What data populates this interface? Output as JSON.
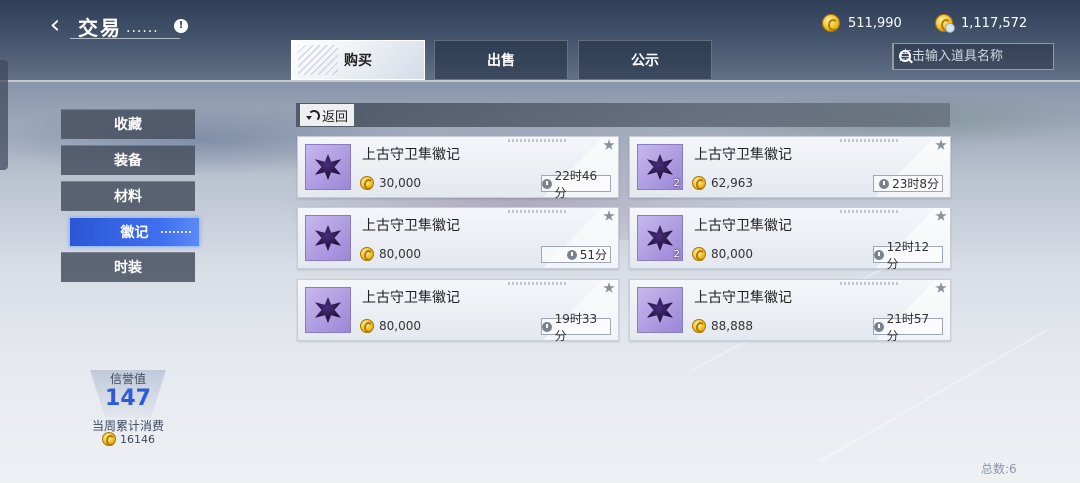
{
  "header": {
    "title": "交易",
    "title_dots": "......",
    "info_label": "!",
    "currencies": [
      {
        "icon": "gold-coin-icon",
        "value": "511,990"
      },
      {
        "icon": "bound-gold-coin-icon",
        "value": "1,117,572"
      }
    ]
  },
  "tabs": [
    {
      "label": "购买",
      "active": true
    },
    {
      "label": "出售",
      "active": false
    },
    {
      "label": "公示",
      "active": false
    }
  ],
  "search": {
    "placeholder": "点击输入道具名称",
    "value": ""
  },
  "categories": [
    {
      "label": "收藏",
      "active": false
    },
    {
      "label": "装备",
      "active": false
    },
    {
      "label": "材料",
      "active": false
    },
    {
      "label": "徽记",
      "active": true
    },
    {
      "label": "时装",
      "active": false
    }
  ],
  "reputation": {
    "label": "信誉值",
    "value": "147",
    "weekly_label": "当周累计消费",
    "weekly_value": "16146"
  },
  "panel": {
    "back_label": "返回"
  },
  "listings": [
    {
      "name": "上古守卫隼徽记",
      "price": "30,000",
      "time": "22时46分",
      "count": ""
    },
    {
      "name": "上古守卫隼徽记",
      "price": "62,963",
      "time": "23时8分",
      "count": "2"
    },
    {
      "name": "上古守卫隼徽记",
      "price": "80,000",
      "time": "51分",
      "count": ""
    },
    {
      "name": "上古守卫隼徽记",
      "price": "80,000",
      "time": "12时12分",
      "count": "2"
    },
    {
      "name": "上古守卫隼徽记",
      "price": "80,000",
      "time": "19时33分",
      "count": ""
    },
    {
      "name": "上古守卫隼徽记",
      "price": "88,888",
      "time": "21时57分",
      "count": ""
    }
  ],
  "footer": {
    "total": "总数:6"
  },
  "colors": {
    "accent": "#2d5bd6",
    "active_category": "#3f6ff0",
    "coin": "#f0c022"
  }
}
